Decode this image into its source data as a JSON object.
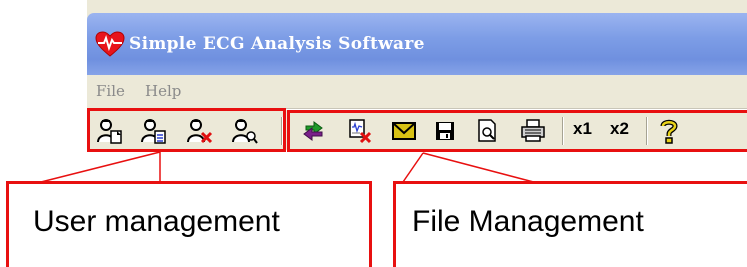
{
  "window": {
    "title": "Simple ECG Analysis Software",
    "app_icon": "heart-ecg-icon"
  },
  "menu": {
    "items": [
      {
        "label": "File"
      },
      {
        "label": "Help"
      }
    ]
  },
  "toolbar": {
    "user_group": [
      {
        "icon": "user-new-icon"
      },
      {
        "icon": "user-edit-icon"
      },
      {
        "icon": "user-delete-icon"
      },
      {
        "icon": "user-search-icon"
      }
    ],
    "file_group": [
      {
        "icon": "transfer-arrows-icon"
      },
      {
        "icon": "delete-record-icon"
      },
      {
        "icon": "envelope-icon"
      },
      {
        "icon": "save-icon"
      },
      {
        "icon": "print-preview-icon"
      },
      {
        "icon": "printer-icon"
      }
    ],
    "zoom": [
      {
        "label": "x1"
      },
      {
        "label": "x2"
      }
    ],
    "help_icon": "help-question-icon"
  },
  "callouts": {
    "user": "User management",
    "file": "File Management"
  },
  "colors": {
    "highlight": "#e81010",
    "titlebar": "#7d9de6",
    "face": "#ece9d8"
  }
}
